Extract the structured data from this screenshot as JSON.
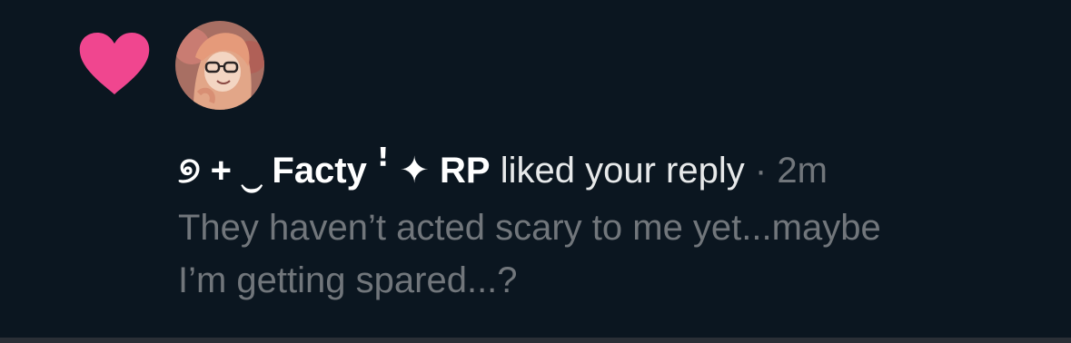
{
  "notification": {
    "type_icon": "heart-icon",
    "type_color": "#f91880",
    "avatar": "user-avatar",
    "liker_name": "୭ + ⏝ Facty ꜝ ✦ RP",
    "action": "liked your reply",
    "separator": "·",
    "time": "2m",
    "reply_text": "They haven’t acted scary to me yet...maybe\nI’m getting spared...?"
  },
  "colors": {
    "background": "#0b1620",
    "primary_text": "#e7e9ea",
    "secondary_text": "#71767b"
  }
}
